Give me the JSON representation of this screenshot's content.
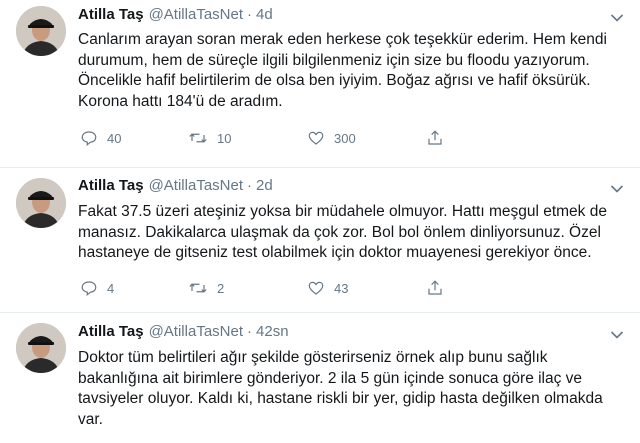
{
  "tweets": [
    {
      "author_name": "Atilla Taş",
      "author_handle": "@AtillaTasNet",
      "separator": "·",
      "time": "4d",
      "lines": [
        "Canlarım arayan soran merak eden herkese çok teşekkür ederim. Hem kendi",
        "durumum, hem de süreçle ilgili bilgilenmeniz için size bu floodu yazıyorum.",
        "Öncelikle hafif belirtilerim de olsa ben iyiyim. Boğaz ağrısı ve hafif öksürük.",
        "Korona hattı 184'ü de aradım."
      ],
      "reply_count": "40",
      "retweet_count": "10",
      "like_count": "300"
    },
    {
      "author_name": "Atilla Taş",
      "author_handle": "@AtillaTasNet",
      "separator": "·",
      "time": "2d",
      "lines": [
        "Fakat 37.5 üzeri ateşiniz yoksa bir müdahele olmuyor. Hattı meşgul etmek de",
        "manasız. Dakikalarca ulaşmak da çok zor. Bol bol önlem dinliyorsunuz. Özel",
        "hastaneye de gitseniz test olabilmek için doktor muayenesi gerekiyor önce."
      ],
      "reply_count": "4",
      "retweet_count": "2",
      "like_count": "43"
    },
    {
      "author_name": "Atilla Taş",
      "author_handle": "@AtillaTasNet",
      "separator": "·",
      "time": "42sn",
      "lines": [
        "Doktor tüm belirtileri ağır şekilde gösterirseniz örnek alıp bunu sağlık",
        "bakanlığına ait birimlere gönderiyor. 2 ila 5 gün içinde sonuca göre ilaç ve",
        "tavsiyeler oluyor. Kaldı ki, hastane riskli bir yer, gidip hasta değilken olmakda",
        "var."
      ]
    }
  ],
  "icons": {
    "reply": "reply-icon",
    "retweet": "retweet-icon",
    "like": "heart-icon",
    "share": "share-icon",
    "caret": "chevron-down-icon"
  },
  "colors": {
    "text": "#14171a",
    "secondary": "#657786",
    "divider": "#e6ecf0"
  }
}
